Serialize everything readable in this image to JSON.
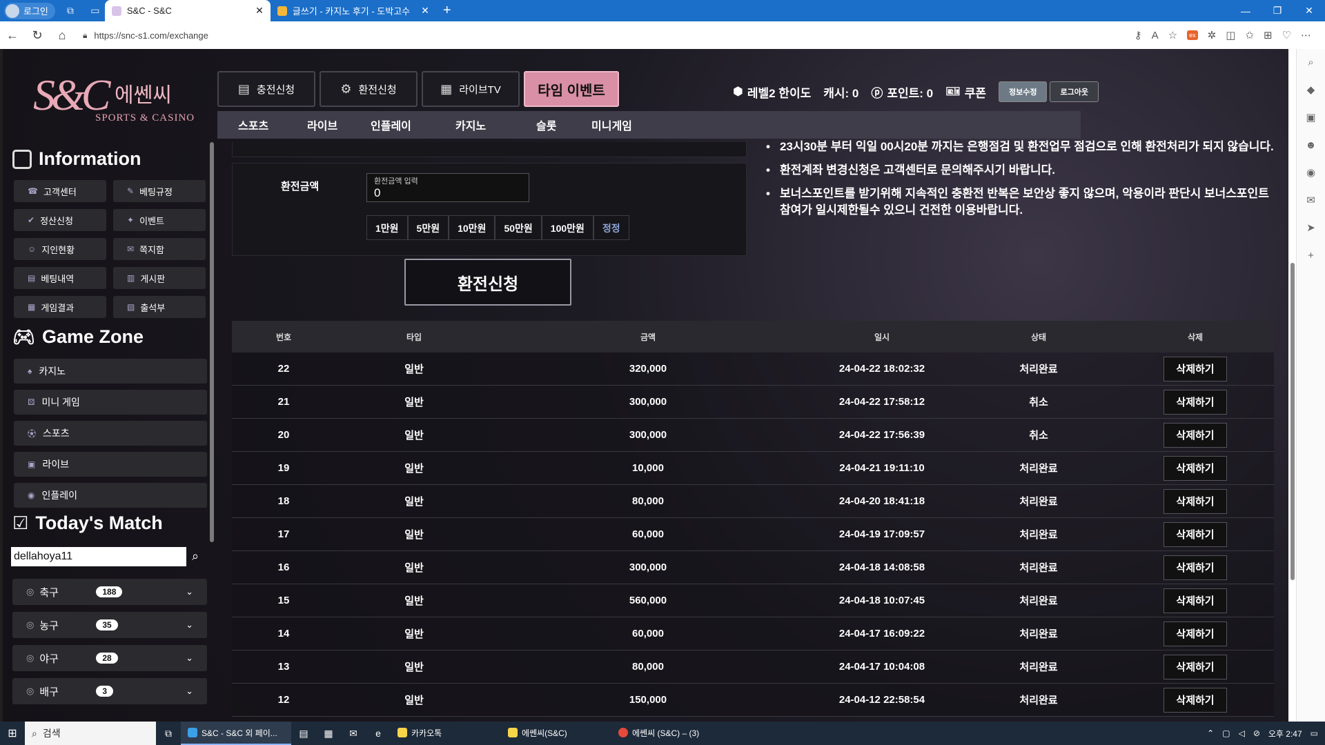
{
  "browser": {
    "profile_label": "로그인",
    "tabs": [
      {
        "title": "S&C - S&C",
        "active": true
      },
      {
        "title": "글쓰기 - 카지노 후기 - 도박고수",
        "active": false
      }
    ],
    "url": "https://snc-s1.com/exchange"
  },
  "site": {
    "logo_kr": "에쎈씨",
    "logo_mark": "S&C",
    "logo_en": "SPORTS & CASINO"
  },
  "top_buttons": [
    {
      "label": "충전신청",
      "icon": "coin-icon"
    },
    {
      "label": "환전신청",
      "icon": "exchange-icon"
    },
    {
      "label": "라이브TV",
      "icon": "tv-icon"
    },
    {
      "label": "타임 이벤트",
      "icon": ""
    }
  ],
  "user": {
    "level": "레벨2 한이도",
    "cash": "캐시: 0",
    "point": "포인트: 0",
    "coupon": "쿠폰",
    "edit_label": "정보수정",
    "logout_label": "로그아웃"
  },
  "subnav": [
    "스포츠",
    "라이브",
    "인플레이",
    "카지노",
    "슬롯",
    "미니게임"
  ],
  "sidebar": {
    "information_title": "Information",
    "info_items": [
      "고객센터",
      "베팅규정",
      "정산신청",
      "이벤트",
      "지인현황",
      "쪽지함",
      "베팅내역",
      "게시판",
      "게임결과",
      "출석부"
    ],
    "gamezone_title": "Game Zone",
    "game_items": [
      "카지노",
      "미니 게임",
      "스포츠",
      "라이브",
      "인플레이"
    ],
    "match_title": "Today's Match",
    "search_value": "dellahoya11",
    "sports": [
      {
        "name": "축구",
        "count": "188"
      },
      {
        "name": "농구",
        "count": "35"
      },
      {
        "name": "야구",
        "count": "28"
      },
      {
        "name": "배구",
        "count": "3"
      }
    ]
  },
  "form": {
    "label": "환전금액",
    "input_caption": "환전금액 입력",
    "input_value": "0",
    "amount_buttons": [
      "1만원",
      "5만원",
      "10만원",
      "50만원",
      "100만원",
      "정정"
    ],
    "submit_label": "환전신청"
  },
  "notices": [
    "23시30분 부터 익일 00시20분 까지는 은행점검 및 환전업무 점검으로 인해 환전처리가 되지 않습니다.",
    "환전계좌 변경신청은 고객센터로 문의해주시기 바랍니다.",
    "보너스포인트를 받기위해 지속적인 충환전 반복은 보안상 좋지 않으며, 악용이라 판단시 보너스포인트 참여가 일시제한될수 있으니 건전한 이용바랍니다."
  ],
  "table": {
    "headers": [
      "번호",
      "타입",
      "금액",
      "일시",
      "상태",
      "삭제"
    ],
    "rows": [
      {
        "no": "22",
        "type": "일반",
        "amount": "320,000",
        "date": "24-04-22 18:02:32",
        "status": "처리완료",
        "action": "삭제하기"
      },
      {
        "no": "21",
        "type": "일반",
        "amount": "300,000",
        "date": "24-04-22 17:58:12",
        "status": "취소",
        "action": "삭제하기"
      },
      {
        "no": "20",
        "type": "일반",
        "amount": "300,000",
        "date": "24-04-22 17:56:39",
        "status": "취소",
        "action": "삭제하기"
      },
      {
        "no": "19",
        "type": "일반",
        "amount": "10,000",
        "date": "24-04-21 19:11:10",
        "status": "처리완료",
        "action": "삭제하기"
      },
      {
        "no": "18",
        "type": "일반",
        "amount": "80,000",
        "date": "24-04-20 18:41:18",
        "status": "처리완료",
        "action": "삭제하기"
      },
      {
        "no": "17",
        "type": "일반",
        "amount": "60,000",
        "date": "24-04-19 17:09:57",
        "status": "처리완료",
        "action": "삭제하기"
      },
      {
        "no": "16",
        "type": "일반",
        "amount": "300,000",
        "date": "24-04-18 14:08:58",
        "status": "처리완료",
        "action": "삭제하기"
      },
      {
        "no": "15",
        "type": "일반",
        "amount": "560,000",
        "date": "24-04-18 10:07:45",
        "status": "처리완료",
        "action": "삭제하기"
      },
      {
        "no": "14",
        "type": "일반",
        "amount": "60,000",
        "date": "24-04-17 16:09:22",
        "status": "처리완료",
        "action": "삭제하기"
      },
      {
        "no": "13",
        "type": "일반",
        "amount": "80,000",
        "date": "24-04-17 10:04:08",
        "status": "처리완료",
        "action": "삭제하기"
      },
      {
        "no": "12",
        "type": "일반",
        "amount": "150,000",
        "date": "24-04-12 22:58:54",
        "status": "처리완료",
        "action": "삭제하기"
      }
    ]
  },
  "taskbar": {
    "search_label": "검색",
    "items": [
      "S&C - S&C 외 페이...",
      "카카오톡",
      "에쎈씨(S&C)",
      "에쎈씨 (S&C) – (3)"
    ],
    "time": "오후 2:47"
  }
}
